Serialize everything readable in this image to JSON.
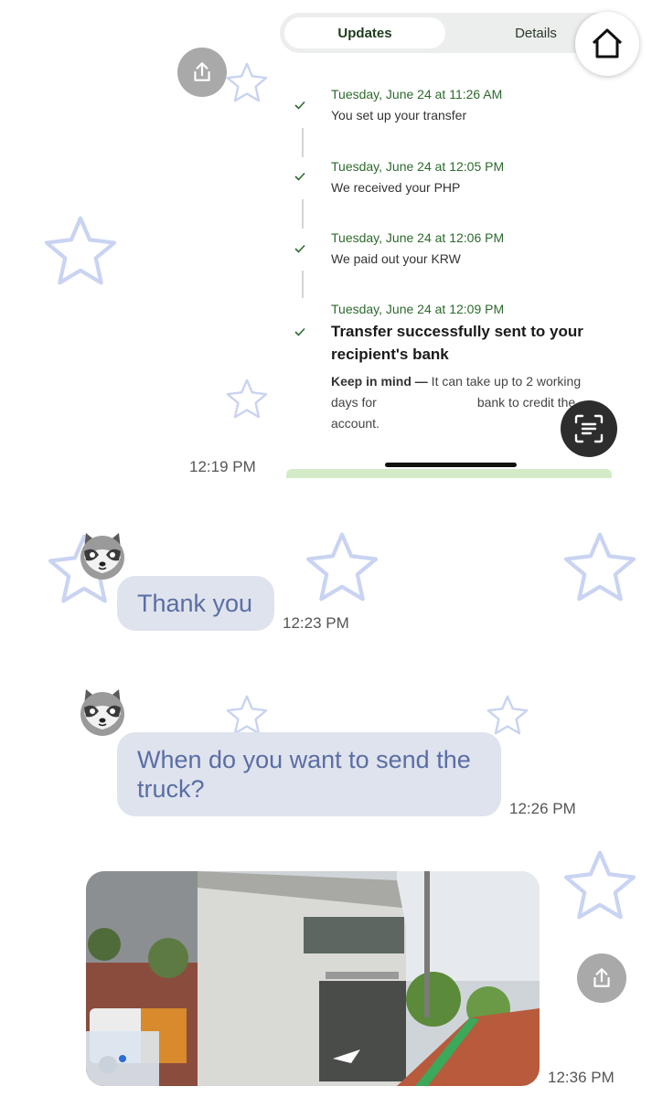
{
  "transfer_screenshot": {
    "tabs": {
      "updates_label": "Updates",
      "details_label": "Details"
    },
    "steps": [
      {
        "date": "Tuesday, June 24 at 11:26 AM",
        "desc": "You set up your transfer"
      },
      {
        "date": "Tuesday, June 24 at 12:05 PM",
        "desc": "We received your PHP"
      },
      {
        "date": "Tuesday, June 24 at 12:06 PM",
        "desc": "We paid out your KRW"
      },
      {
        "date": "Tuesday, June 24 at 12:09 PM",
        "desc": "Transfer successfully sent to your recipient's bank"
      }
    ],
    "note_bold": "Keep in mind —",
    "note_text_1": " It can take up to 2 working days for",
    "note_text_2": "bank to credit the account."
  },
  "messages": [
    {
      "type": "image",
      "time": "12:19 PM"
    },
    {
      "type": "text",
      "text": "Thank you",
      "time": "12:23 PM"
    },
    {
      "type": "text",
      "text": "When do you want to send the truck?",
      "time": "12:26 PM"
    },
    {
      "type": "image",
      "time": "12:36 PM"
    }
  ],
  "colors": {
    "bubble": "#dfe3ee",
    "bubble_text": "#5a6ea4",
    "star": "#c9d3f2",
    "accent_green": "#2d6a2d"
  },
  "icons": [
    "share-icon",
    "home-icon",
    "scan-text-icon",
    "checkmark-icon",
    "star-icon",
    "raccoon-avatar"
  ]
}
